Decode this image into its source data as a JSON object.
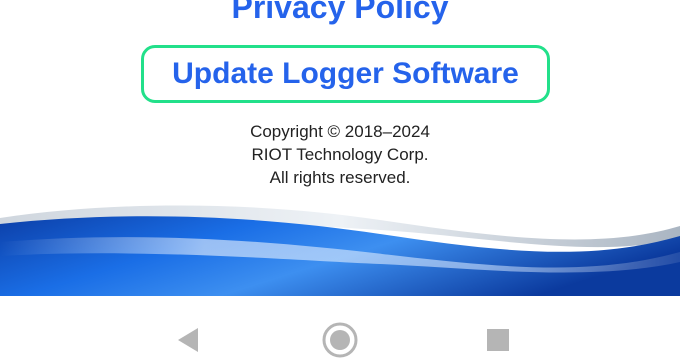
{
  "links": {
    "privacy": "Privacy Policy",
    "update_software": "Update Logger Software"
  },
  "copyright": {
    "line1": "Copyright © 2018–2024",
    "line2": "RIOT Technology Corp.",
    "line3": "All rights reserved."
  },
  "colors": {
    "link": "#2563eb",
    "focus_ring": "#22e08a",
    "wave_primary": "#1457c9",
    "nav_icon": "#b5b5b5"
  },
  "navbar": {
    "icons": [
      "back-icon",
      "home-icon",
      "recents-icon"
    ]
  }
}
